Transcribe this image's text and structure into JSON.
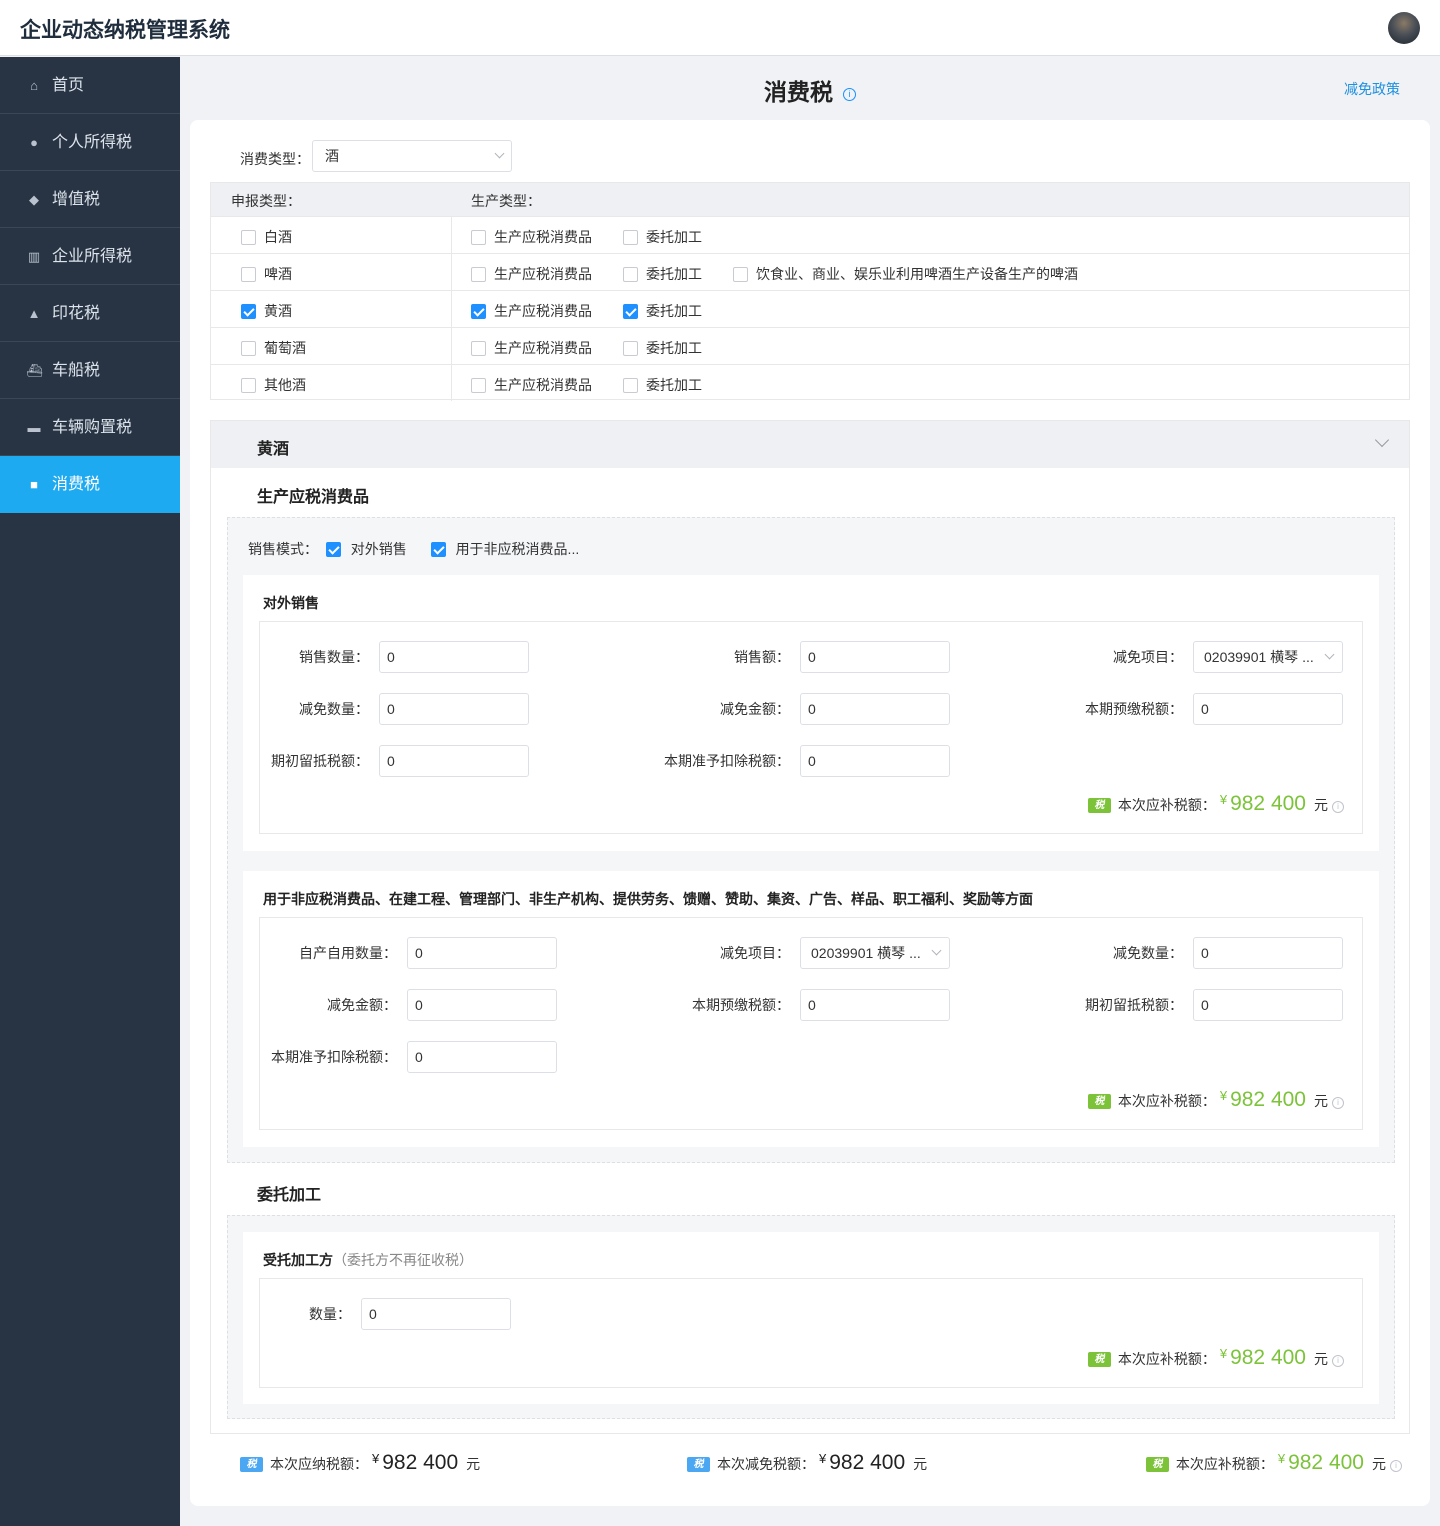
{
  "app": {
    "title": "企业动态纳税管理系统"
  },
  "sidebar": {
    "items": [
      {
        "label": "首页",
        "icon": "home-icon",
        "glyph": "⌂"
      },
      {
        "label": "个人所得税",
        "icon": "user-icon",
        "glyph": "●"
      },
      {
        "label": "增值税",
        "icon": "diamond-icon",
        "glyph": "◆"
      },
      {
        "label": "企业所得税",
        "icon": "building-icon",
        "glyph": "▥"
      },
      {
        "label": "印花税",
        "icon": "stamp-icon",
        "glyph": "▲"
      },
      {
        "label": "车船税",
        "icon": "ship-icon",
        "glyph": "⛴"
      },
      {
        "label": "车辆购置税",
        "icon": "car-icon",
        "glyph": "▬"
      },
      {
        "label": "消费税",
        "icon": "bag-icon",
        "glyph": "■"
      }
    ],
    "active_index": 7
  },
  "page": {
    "title": "消费税",
    "info_glyph": "i",
    "policy_link": "减免政策"
  },
  "filter": {
    "label": "消费类型：",
    "value": "酒"
  },
  "declaration": {
    "head_type": "申报类型：",
    "head_prod": "生产类型：",
    "rows": [
      {
        "type": "白酒",
        "type_checked": false,
        "opts": [
          {
            "label": "生产应税消费品",
            "checked": false
          },
          {
            "label": "委托加工",
            "checked": false
          }
        ]
      },
      {
        "type": "啤酒",
        "type_checked": false,
        "opts": [
          {
            "label": "生产应税消费品",
            "checked": false
          },
          {
            "label": "委托加工",
            "checked": false
          },
          {
            "label": "饮食业、商业、娱乐业利用啤酒生产设备生产的啤酒",
            "checked": false
          }
        ]
      },
      {
        "type": "黄酒",
        "type_checked": true,
        "opts": [
          {
            "label": "生产应税消费品",
            "checked": true
          },
          {
            "label": "委托加工",
            "checked": true
          }
        ]
      },
      {
        "type": "葡萄酒",
        "type_checked": false,
        "opts": [
          {
            "label": "生产应税消费品",
            "checked": false
          },
          {
            "label": "委托加工",
            "checked": false
          }
        ]
      },
      {
        "type": "其他酒",
        "type_checked": false,
        "opts": [
          {
            "label": "生产应税消费品",
            "checked": false
          },
          {
            "label": "委托加工",
            "checked": false
          }
        ]
      }
    ]
  },
  "wine_section": {
    "title": "黄酒",
    "production": {
      "title": "生产应税消费品",
      "sales_mode_label": "销售模式：",
      "mode_external": "对外销售",
      "mode_external_checked": true,
      "mode_internal": "用于非应税消费品...",
      "mode_internal_checked": true,
      "external": {
        "title": "对外销售",
        "fields": {
          "sales_qty": {
            "label": "销售数量：",
            "value": "0"
          },
          "sales_amount": {
            "label": "销售额：",
            "value": "0"
          },
          "exempt_item": {
            "label": "减免项目：",
            "value": "02039901 横琴 ..."
          },
          "exempt_qty": {
            "label": "减免数量：",
            "value": "0"
          },
          "exempt_amount": {
            "label": "减免金额：",
            "value": "0"
          },
          "prepaid": {
            "label": "本期预缴税额：",
            "value": "0"
          },
          "opening_credit": {
            "label": "期初留抵税额：",
            "value": "0"
          },
          "deductible": {
            "label": "本期准予扣除税额：",
            "value": "0"
          }
        },
        "result": {
          "badge": "税",
          "label": "本次应补税额：",
          "currency": "¥",
          "amount": "982 400",
          "unit": "元"
        }
      },
      "internal": {
        "title": "用于非应税消费品、在建工程、管理部门、非生产机构、提供劳务、馈赠、赞助、集资、广告、样品、职工福利、奖励等方面",
        "fields": {
          "self_use_qty": {
            "label": "自产自用数量：",
            "value": "0"
          },
          "exempt_item": {
            "label": "减免项目：",
            "value": "02039901 横琴 ..."
          },
          "exempt_qty": {
            "label": "减免数量：",
            "value": "0"
          },
          "exempt_amount": {
            "label": "减免金额：",
            "value": "0"
          },
          "prepaid": {
            "label": "本期预缴税额：",
            "value": "0"
          },
          "opening_credit": {
            "label": "期初留抵税额：",
            "value": "0"
          },
          "deductible": {
            "label": "本期准予扣除税额：",
            "value": "0"
          }
        },
        "result": {
          "badge": "税",
          "label": "本次应补税额：",
          "currency": "¥",
          "amount": "982 400",
          "unit": "元"
        }
      }
    },
    "entrusted": {
      "title": "委托加工",
      "panel_title": "受托加工方",
      "panel_hint": "（委托方不再征收税）",
      "qty": {
        "label": "数量：",
        "value": "0"
      },
      "result": {
        "badge": "税",
        "label": "本次应补税额：",
        "currency": "¥",
        "amount": "982 400",
        "unit": "元"
      }
    }
  },
  "summary": {
    "payable": {
      "badge": "税",
      "label": "本次应纳税额：",
      "currency": "¥",
      "amount": "982 400",
      "unit": "元"
    },
    "exempt": {
      "badge": "税",
      "label": "本次减免税额：",
      "currency": "¥",
      "amount": "982 400",
      "unit": "元"
    },
    "supplement": {
      "badge": "税",
      "label": "本次应补税额：",
      "currency": "¥",
      "amount": "982 400",
      "unit": "元"
    }
  },
  "colors": {
    "primary": "#1eaaf1",
    "sidebar_bg": "#283443",
    "accent_green": "#7cc33a",
    "link_blue": "#1e90e0"
  }
}
